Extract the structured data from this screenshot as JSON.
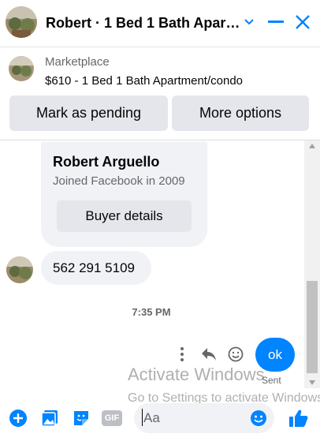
{
  "header": {
    "title": "Robert · 1 Bed 1 Bath Apar…",
    "icons": [
      "chevron-down-icon",
      "minimize-icon",
      "close-icon"
    ]
  },
  "listing": {
    "label": "Marketplace",
    "title": "$610 - 1 Bed 1 Bath Apartment/condo"
  },
  "actions": {
    "pending": "Mark as pending",
    "more": "More options"
  },
  "profile_card": {
    "name": "Robert Arguello",
    "joined": "Joined Facebook in 2009",
    "button": "Buyer details"
  },
  "messages": [
    {
      "from": "Robert",
      "text": "562 291 5109"
    },
    {
      "from": "me",
      "text": "ok",
      "status": "Sent"
    }
  ],
  "timestamp": "7:35 PM",
  "watermark": {
    "line1": "Activate Windows",
    "line2": "Go to Settings to activate Windows."
  },
  "composer": {
    "placeholder": "Aa",
    "gif_label": "GIF"
  },
  "colors": {
    "accent": "#0084ff",
    "bubble": "#f0f2f5",
    "button": "#e4e6eb"
  }
}
